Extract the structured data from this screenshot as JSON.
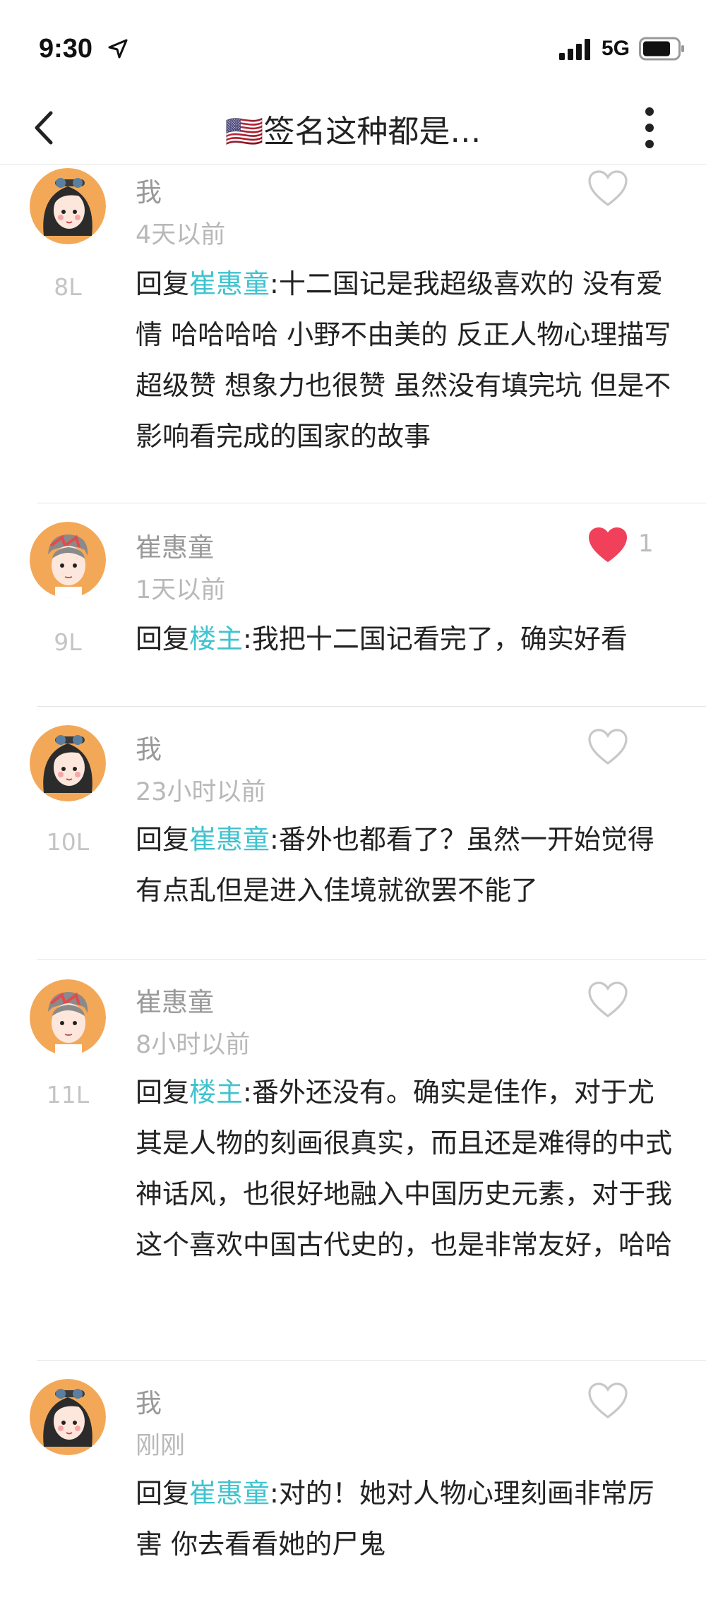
{
  "status_bar": {
    "time": "9:30",
    "network": "5G",
    "icons": [
      "location-arrow-icon",
      "signal-bars-icon",
      "battery-icon"
    ]
  },
  "nav": {
    "title": "🇺🇸签名这种都是…",
    "back_icon": "chevron-left-icon",
    "more_icon": "more-vertical-icon"
  },
  "colors": {
    "mention": "#3fc3cf",
    "like_active": "#f0405a",
    "avatar_bg": "#f3a858"
  },
  "comments": [
    {
      "author": "我",
      "time": "4天以前",
      "floor": "8L",
      "reply_prefix": "回复",
      "mention": "崔惠童",
      "text": ":十二国记是我超级喜欢的 没有爱情 哈哈哈哈 小野不由美的 反正人物心理描写超级赞 想象力也很赞 虽然没有填完坑 但是不影响看完成的国家的故事",
      "liked": false,
      "like_count": ""
    },
    {
      "author": "崔惠童",
      "time": "1天以前",
      "floor": "9L",
      "reply_prefix": "回复",
      "mention": "楼主",
      "text": ":我把十二国记看完了，确实好看",
      "liked": true,
      "like_count": "1"
    },
    {
      "author": "我",
      "time": "23小时以前",
      "floor": "10L",
      "reply_prefix": "回复",
      "mention": "崔惠童",
      "text": ":番外也都看了？虽然一开始觉得有点乱但是进入佳境就欲罢不能了",
      "liked": false,
      "like_count": ""
    },
    {
      "author": "崔惠童",
      "time": "8小时以前",
      "floor": "11L",
      "reply_prefix": "回复",
      "mention": "楼主",
      "text": ":番外还没有。确实是佳作，对于尤其是人物的刻画很真实，而且还是难得的中式神话风，也很好地融入中国历史元素，对于我这个喜欢中国古代史的，也是非常友好，哈哈",
      "liked": false,
      "like_count": ""
    },
    {
      "author": "我",
      "time": "刚刚",
      "floor": "",
      "reply_prefix": "回复",
      "mention": "崔惠童",
      "text": ":对的！她对人物心理刻画非常厉害 你去看看她的尸鬼",
      "liked": false,
      "like_count": ""
    }
  ]
}
